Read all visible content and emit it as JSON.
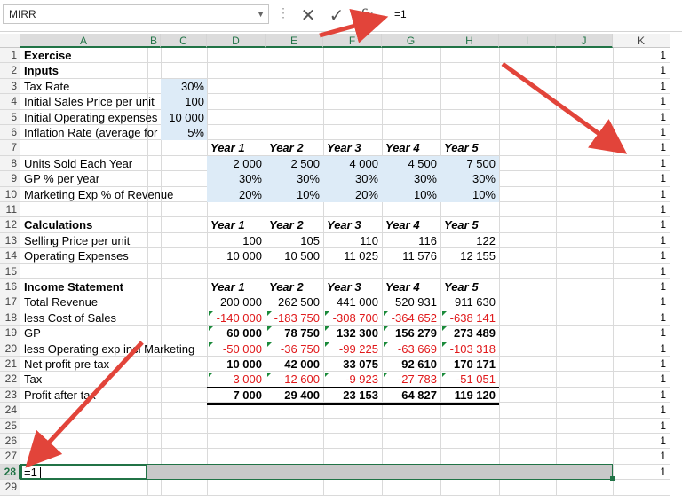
{
  "formula_bar": {
    "name_box": "MIRR",
    "cancel_icon": "✕",
    "enter_icon": "✓",
    "fx_label": "fx",
    "formula": "=1"
  },
  "columns": [
    "A",
    "B",
    "C",
    "D",
    "E",
    "F",
    "G",
    "H",
    "I",
    "J",
    "K"
  ],
  "rows": [
    "1",
    "2",
    "3",
    "4",
    "5",
    "6",
    "7",
    "8",
    "9",
    "10",
    "11",
    "12",
    "13",
    "14",
    "15",
    "16",
    "17",
    "18",
    "19",
    "20",
    "21",
    "22",
    "23",
    "24",
    "25",
    "26",
    "27",
    "28",
    "29"
  ],
  "labels": {
    "r1": "Exercise",
    "r2": "Inputs",
    "r3": "Tax Rate",
    "r4": "Initial Sales Price per unit",
    "r5": "Initial Operating expenses",
    "r6": "Inflation Rate (average for",
    "r8": "Units Sold Each Year",
    "r9": "GP % per year",
    "r10": "Marketing Exp % of Revenue",
    "r12": "Calculations",
    "r13": "Selling Price per unit",
    "r14": "Operating Expenses",
    "r16": "Income Statement",
    "r17": "Total Revenue",
    "r18": "less Cost of Sales",
    "r19": "GP",
    "r20": "less Operating exp incl Marketing",
    "r21": "Net profit pre tax",
    "r22": "Tax",
    "r23": "Profit after tax",
    "r28": "=1"
  },
  "inputs": {
    "c3": "30%",
    "c4": "100",
    "c5": "10 000",
    "c6": "5%"
  },
  "year_headers": [
    "Year 1",
    "Year 2",
    "Year 3",
    "Year 4",
    "Year 5"
  ],
  "table": {
    "r8": [
      "2 000",
      "2 500",
      "4 000",
      "4 500",
      "7 500"
    ],
    "r9": [
      "30%",
      "30%",
      "30%",
      "30%",
      "30%"
    ],
    "r10": [
      "20%",
      "10%",
      "20%",
      "10%",
      "10%"
    ],
    "r13": [
      "100",
      "105",
      "110",
      "116",
      "122"
    ],
    "r14": [
      "10 000",
      "10 500",
      "11 025",
      "11 576",
      "12 155"
    ],
    "r17": [
      "200 000",
      "262 500",
      "441 000",
      "520 931",
      "911 630"
    ],
    "r18": [
      "-140 000",
      "-183 750",
      "-308 700",
      "-364 652",
      "-638 141"
    ],
    "r19": [
      "60 000",
      "78 750",
      "132 300",
      "156 279",
      "273 489"
    ],
    "r20": [
      "-50 000",
      "-36 750",
      "-99 225",
      "-63 669",
      "-103 318"
    ],
    "r21": [
      "10 000",
      "42 000",
      "33 075",
      "92 610",
      "170 171"
    ],
    "r22": [
      "-3 000",
      "-12 600",
      "-9 923",
      "-27 783",
      "-51 051"
    ],
    "r23": [
      "7 000",
      "29 400",
      "23 153",
      "64 827",
      "119 120"
    ]
  },
  "k_value": "1",
  "colors": {
    "accent": "#217346",
    "input_fill": "#ddebf7",
    "negative": "#e0191b",
    "arrow": "#e2443a"
  }
}
